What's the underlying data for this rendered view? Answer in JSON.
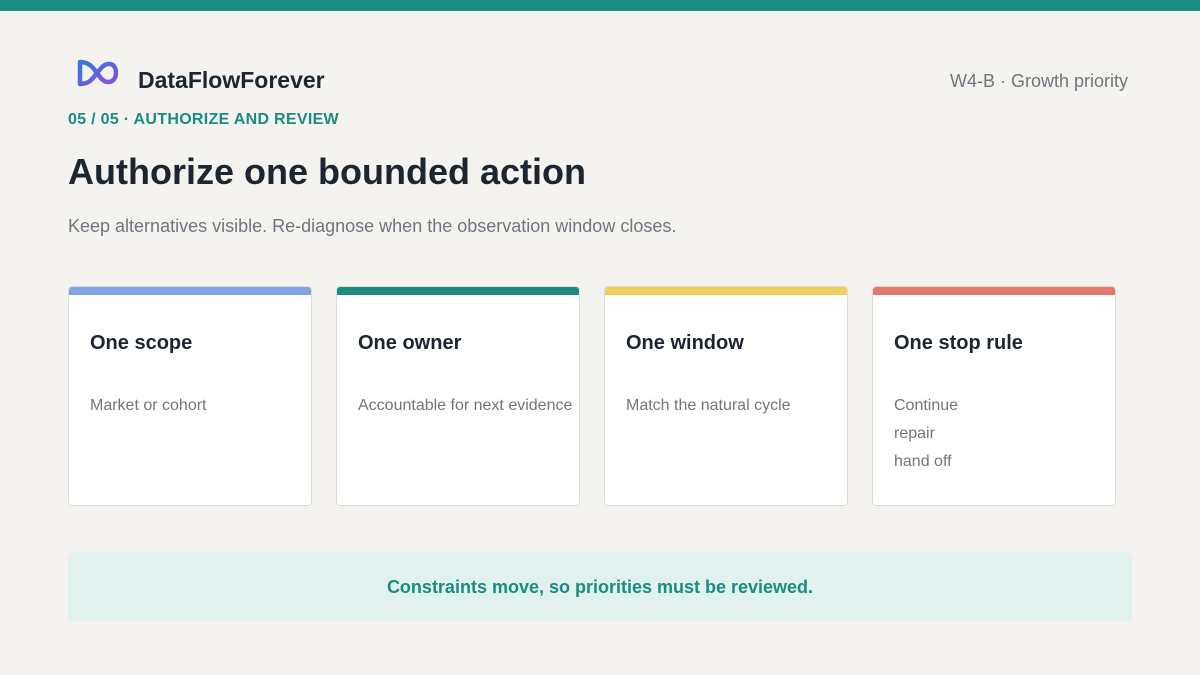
{
  "brand": {
    "name": "DataFlowForever",
    "logo_icon": "infinity-logo-icon"
  },
  "meta": "W4-B · Growth priority",
  "eyebrow": "05 / 05 · AUTHORIZE AND REVIEW",
  "title": "Authorize one bounded action",
  "subtitle": "Keep alternatives visible. Re-diagnose when the observation window closes.",
  "cards": [
    {
      "title": "One scope",
      "lines": [
        "Market or cohort"
      ],
      "accent": "#7ea6e6"
    },
    {
      "title": "One owner",
      "lines": [
        "Accountable for next evidence"
      ],
      "accent": "#1a8c80"
    },
    {
      "title": "One window",
      "lines": [
        "Match the natural cycle"
      ],
      "accent": "#f0cf5a"
    },
    {
      "title": "One stop rule",
      "lines": [
        "Continue",
        "repair",
        "hand off"
      ],
      "accent": "#e4766b"
    }
  ],
  "banner": "Constraints move, so priorities must be reviewed.",
  "colors": {
    "brand_teal": "#1a8c80",
    "background": "#f4f3ef",
    "banner_bg": "#e1f1ee"
  }
}
